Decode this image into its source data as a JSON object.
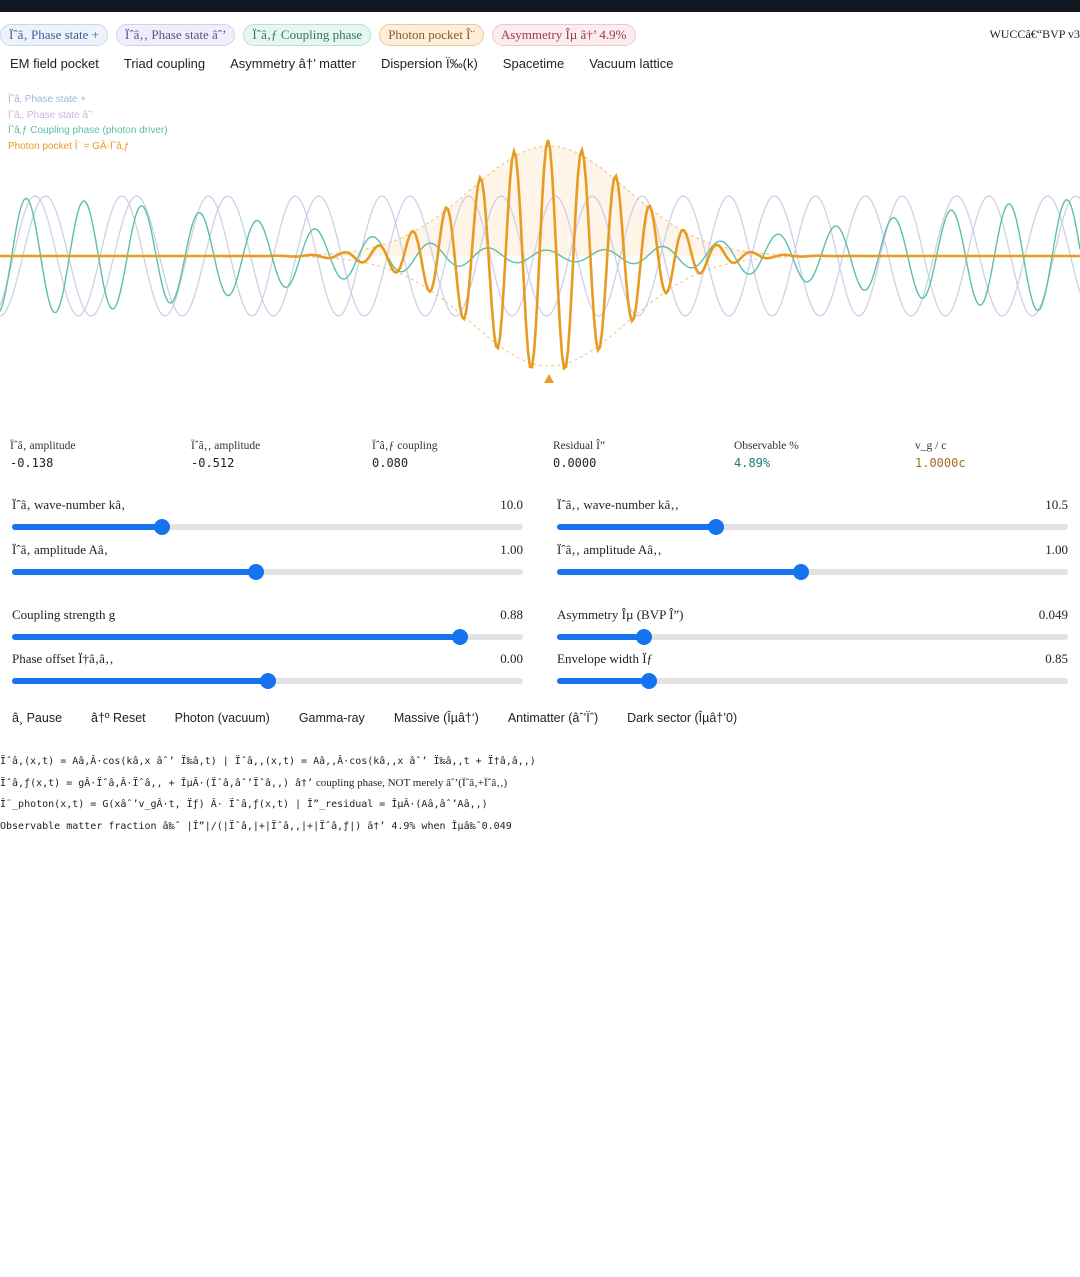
{
  "header": {
    "pills": [
      "Ïˆâ‚ Phase state +",
      "Ïˆâ‚‚ Phase state âˆ’",
      "Ïˆâ‚ƒ Coupling phase",
      "Photon pocket Î¨",
      "Asymmetry Îµ â†’ 4.9%"
    ],
    "version": "WUCCâ€“BVP v3"
  },
  "tabs": [
    "EM field pocket",
    "Triad coupling",
    "Asymmetry â†’ matter",
    "Dispersion Ï‰(k)",
    "Spacetime",
    "Vacuum lattice"
  ],
  "legend": {
    "items": [
      {
        "label": "Ïˆâ‚ Phase state +",
        "color": "#9fb6df"
      },
      {
        "label": "Ïˆâ‚‚ Phase state âˆ’",
        "color": "#c4b9e0"
      },
      {
        "label": "Ïˆâ‚ƒ Coupling phase (photon driver)",
        "color": "#5cc0a4"
      },
      {
        "label": "Photon pocket Î¨ = GÂ·Ïˆâ‚ƒ",
        "color": "#e79b22"
      }
    ]
  },
  "colors": {
    "psi1": "#c5d3ea",
    "psi2": "#d5cde8",
    "psi3": "#5cc0a4",
    "pocket": "#e79b22",
    "accent": "#1673f0"
  },
  "stats": [
    {
      "label": "Ïˆâ‚ amplitude",
      "value": "-0.138",
      "color": "#222222"
    },
    {
      "label": "Ïˆâ‚‚ amplitude",
      "value": "-0.512",
      "color": "#222222"
    },
    {
      "label": "Ïˆâ‚ƒ coupling",
      "value": "0.080",
      "color": "#222222"
    },
    {
      "label": "Residual Î”",
      "value": "0.0000",
      "color": "#222222"
    },
    {
      "label": "Observable %",
      "value": "4.89%",
      "color": "#1f7a7a"
    },
    {
      "label": "v_g / c",
      "value": "1.0000c",
      "color": "#a07020"
    }
  ],
  "sliders": [
    {
      "label": "Ïˆâ‚ wave-number kâ‚",
      "display": "10.0",
      "fraction": 0.294
    },
    {
      "label": "Ïˆâ‚‚ wave-number kâ‚‚",
      "display": "10.5",
      "fraction": 0.311
    },
    {
      "label": "Ïˆâ‚ amplitude Aâ‚",
      "display": "1.00",
      "fraction": 0.477
    },
    {
      "label": "Ïˆâ‚‚ amplitude Aâ‚‚",
      "display": "1.00",
      "fraction": 0.477
    },
    {
      "label": "Coupling strength g",
      "display": "0.88",
      "fraction": 0.876
    },
    {
      "label": "Asymmetry Îµ (BVP Î”)",
      "display": "0.049",
      "fraction": 0.17
    },
    {
      "label": "Phase offset Ï†â‚â‚‚",
      "display": "0.00",
      "fraction": 0.5
    },
    {
      "label": "Envelope width Ïƒ",
      "display": "0.85",
      "fraction": 0.18
    }
  ],
  "buttons": [
    "â¸ Pause",
    "â†º Reset",
    "Photon (vacuum)",
    "Gamma-ray",
    "Massive (Îµâ†‘)",
    "Antimatter (âˆ’Ïˆ)",
    "Dark sector (Îµâ†’0)"
  ],
  "equations": {
    "line1": "Ïˆâ‚(x,t) = Aâ‚Â·cos(kâ‚x âˆ’ Ï‰â‚t) | Ïˆâ‚‚(x,t) = Aâ‚‚Â·cos(kâ‚‚x âˆ’ Ï‰â‚‚t + Ï†â‚â‚‚)",
    "line2_code": "Ïˆâ‚ƒ(x,t) = gÂ·Ïˆâ‚Â·Ïˆâ‚‚ + ÎµÂ·(Ïˆâ‚âˆ’Ïˆâ‚‚)  â†’",
    "line2_text": " coupling phase, NOT merely âˆ’(Ïˆâ‚+Ïˆâ‚‚)",
    "line3": "Î¨_photon(x,t) = G(xâˆ’v_gÂ·t, Ïƒ) Â· Ïˆâ‚ƒ(x,t) | Î”_residual = ÎµÂ·(Aâ‚âˆ’Aâ‚‚)",
    "line4": "Observable matter fraction â‰ˆ |Î”|/(|Ïˆâ‚|+|Ïˆâ‚‚|+|Ïˆâ‚ƒ|) â†’ 4.9% when Îµâ‰ˆ0.049"
  }
}
